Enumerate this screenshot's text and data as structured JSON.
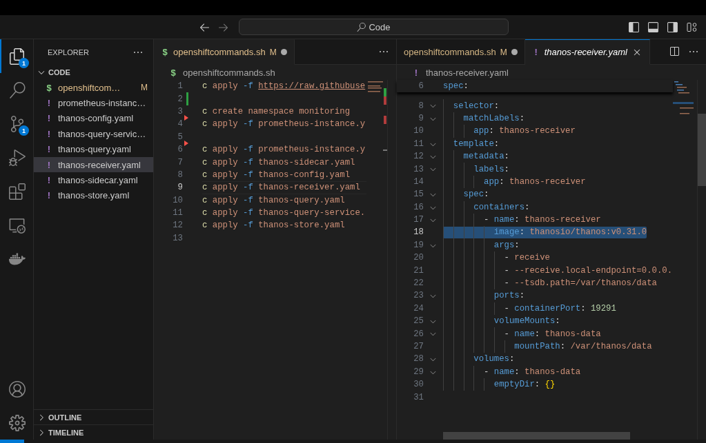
{
  "title_bar": {
    "search": "Code"
  },
  "activity_bar": [
    {
      "kind": "explorer",
      "selected": true,
      "badge": "1"
    },
    {
      "kind": "search",
      "selected": false
    },
    {
      "kind": "source-control",
      "selected": false,
      "badge": "1"
    },
    {
      "kind": "run-debug",
      "selected": false
    },
    {
      "kind": "extensions",
      "selected": false
    },
    {
      "kind": "remote",
      "selected": false
    },
    {
      "kind": "docker",
      "selected": false
    }
  ],
  "activity_bottom": [
    {
      "kind": "account"
    },
    {
      "kind": "settings"
    }
  ],
  "sidebar": {
    "title": "EXPLORER",
    "section": {
      "label": "CODE",
      "expanded": true,
      "files": [
        {
          "icon": "$",
          "kind": "shell",
          "name": "openshiftcom…",
          "status": "M",
          "selected": false
        },
        {
          "icon": "!",
          "kind": "yaml",
          "name": "prometheus-instanc…",
          "selected": false
        },
        {
          "icon": "!",
          "kind": "yaml",
          "name": "thanos-config.yaml",
          "selected": false
        },
        {
          "icon": "!",
          "kind": "yaml",
          "name": "thanos-query-servic…",
          "selected": false
        },
        {
          "icon": "!",
          "kind": "yaml",
          "name": "thanos-query.yaml",
          "selected": false
        },
        {
          "icon": "!",
          "kind": "yaml",
          "name": "thanos-receiver.yaml",
          "selected": true
        },
        {
          "icon": "!",
          "kind": "yaml",
          "name": "thanos-sidecar.yaml",
          "selected": false
        },
        {
          "icon": "!",
          "kind": "yaml",
          "name": "thanos-store.yaml",
          "selected": false
        }
      ]
    },
    "collapsed_sections": [
      {
        "label": "OUTLINE",
        "expanded": false
      },
      {
        "label": "TIMELINE",
        "expanded": false
      }
    ]
  },
  "editors": [
    {
      "tabs": [
        {
          "icon": "$",
          "kind": "shell",
          "label": "openshiftcommands.sh",
          "status": "M",
          "dirty": true,
          "selected": true,
          "preview": false,
          "focused": false
        }
      ],
      "breadcrumb": {
        "icon": "$",
        "kind": "shell",
        "label": "openshiftcommands.sh"
      },
      "lines": [
        {
          "n": "1",
          "kind": "code",
          "tokens": [
            {
              "text": "c",
              "kind": "cmd"
            },
            {
              "text": " apply ",
              "kind": "str"
            },
            {
              "text": "-f ",
              "kind": "flag"
            },
            {
              "text": "https://raw.githubuse",
              "kind": "link"
            }
          ]
        },
        {
          "n": "2",
          "kind": "added"
        },
        {
          "n": "3",
          "kind": "code",
          "tokens": [
            {
              "text": "c",
              "kind": "cmd"
            },
            {
              "text": " create namespace monitoring",
              "kind": "str"
            }
          ]
        },
        {
          "n": "4",
          "kind": "deleted",
          "tokens": [
            {
              "text": "c",
              "kind": "cmd"
            },
            {
              "text": " apply ",
              "kind": "str"
            },
            {
              "text": "-f",
              "kind": "flag"
            },
            {
              "text": " prometheus-instance.y",
              "kind": "str"
            }
          ]
        },
        {
          "n": "5",
          "kind": "code"
        },
        {
          "n": "6",
          "kind": "deleted",
          "tokens": [
            {
              "text": "c",
              "kind": "cmd"
            },
            {
              "text": " apply ",
              "kind": "str"
            },
            {
              "text": "-f",
              "kind": "flag"
            },
            {
              "text": " prometheus-instance.y",
              "kind": "str"
            }
          ]
        },
        {
          "n": "7",
          "kind": "code",
          "tokens": [
            {
              "text": "c",
              "kind": "cmd"
            },
            {
              "text": " apply ",
              "kind": "str"
            },
            {
              "text": "-f",
              "kind": "flag"
            },
            {
              "text": " thanos-sidecar.yaml",
              "kind": "str"
            }
          ]
        },
        {
          "n": "8",
          "kind": "code",
          "tokens": [
            {
              "text": "c",
              "kind": "cmd"
            },
            {
              "text": " apply ",
              "kind": "str"
            },
            {
              "text": "-f",
              "kind": "flag"
            },
            {
              "text": " thanos-config.yaml",
              "kind": "str"
            }
          ]
        },
        {
          "n": "9",
          "kind": "code",
          "current": true,
          "tokens": [
            {
              "text": "c",
              "kind": "cmd"
            },
            {
              "text": " apply ",
              "kind": "str"
            },
            {
              "text": "-f",
              "kind": "flag"
            },
            {
              "text": " thanos-receiver.yaml",
              "kind": "str"
            }
          ]
        },
        {
          "n": "10",
          "kind": "code",
          "tokens": [
            {
              "text": "c",
              "kind": "cmd"
            },
            {
              "text": " apply ",
              "kind": "str"
            },
            {
              "text": "-f",
              "kind": "flag"
            },
            {
              "text": " thanos-query.yaml",
              "kind": "str"
            }
          ]
        },
        {
          "n": "11",
          "kind": "code",
          "tokens": [
            {
              "text": "c",
              "kind": "cmd"
            },
            {
              "text": " apply ",
              "kind": "str"
            },
            {
              "text": "-f",
              "kind": "flag"
            },
            {
              "text": " thanos-query-service.",
              "kind": "str"
            }
          ]
        },
        {
          "n": "12",
          "kind": "code",
          "tokens": [
            {
              "text": "c",
              "kind": "cmd"
            },
            {
              "text": " apply ",
              "kind": "str"
            },
            {
              "text": "-f",
              "kind": "flag"
            },
            {
              "text": " thanos-store.yaml",
              "kind": "str"
            }
          ]
        },
        {
          "n": "13",
          "kind": "code"
        }
      ]
    },
    {
      "tabs": [
        {
          "label": "openshiftcommands.sh",
          "status": "M",
          "dirty": true,
          "selected": false,
          "preview": false,
          "focused": false
        },
        {
          "icon": "!",
          "kind": "yaml",
          "label": "thanos-receiver.yaml",
          "dirty": false,
          "selected": true,
          "preview": true,
          "focused": true
        }
      ],
      "breadcrumb": {
        "icon": "!",
        "kind": "yaml",
        "label": "thanos-receiver.yaml"
      },
      "sticky": {
        "n": "6",
        "tokens": [
          {
            "text": "spec",
            "kind": "key"
          },
          {
            "text": ":",
            "kind": "punct"
          }
        ]
      },
      "lines": [
        {
          "n": "8",
          "kind": "code",
          "fold": true,
          "tokens": [
            {
              "text": "  selector",
              "kind": "key"
            },
            {
              "text": ":",
              "kind": "punct"
            }
          ]
        },
        {
          "n": "9",
          "kind": "code",
          "fold": true,
          "tokens": [
            {
              "text": "    matchLabels",
              "kind": "key"
            },
            {
              "text": ":",
              "kind": "punct"
            }
          ]
        },
        {
          "n": "10",
          "kind": "code",
          "tokens": [
            {
              "text": "      app",
              "kind": "key"
            },
            {
              "text": ": ",
              "kind": "punct"
            },
            {
              "text": "thanos-receiver",
              "kind": "str"
            }
          ]
        },
        {
          "n": "11",
          "kind": "code",
          "fold": true,
          "tokens": [
            {
              "text": "  template",
              "kind": "key"
            },
            {
              "text": ":",
              "kind": "punct"
            }
          ]
        },
        {
          "n": "12",
          "kind": "code",
          "fold": true,
          "tokens": [
            {
              "text": "    metadata",
              "kind": "key"
            },
            {
              "text": ":",
              "kind": "punct"
            }
          ]
        },
        {
          "n": "13",
          "kind": "code",
          "fold": true,
          "tokens": [
            {
              "text": "      labels",
              "kind": "key"
            },
            {
              "text": ":",
              "kind": "punct"
            }
          ]
        },
        {
          "n": "14",
          "kind": "code",
          "tokens": [
            {
              "text": "        app",
              "kind": "key"
            },
            {
              "text": ": ",
              "kind": "punct"
            },
            {
              "text": "thanos-receiver",
              "kind": "str"
            }
          ]
        },
        {
          "n": "15",
          "kind": "code",
          "fold": true,
          "tokens": [
            {
              "text": "    spec",
              "kind": "key"
            },
            {
              "text": ":",
              "kind": "punct"
            }
          ]
        },
        {
          "n": "16",
          "kind": "code",
          "fold": true,
          "tokens": [
            {
              "text": "      containers",
              "kind": "key"
            },
            {
              "text": ":",
              "kind": "punct"
            }
          ]
        },
        {
          "n": "17",
          "kind": "code",
          "fold": true,
          "tokens": [
            {
              "text": "        - ",
              "kind": "punct"
            },
            {
              "text": "name",
              "kind": "key"
            },
            {
              "text": ": ",
              "kind": "punct"
            },
            {
              "text": "thanos-receiver",
              "kind": "str"
            }
          ]
        },
        {
          "n": "18",
          "kind": "code",
          "current": true,
          "selected": true,
          "tokens": [
            {
              "text": "          image",
              "kind": "key"
            },
            {
              "text": ": ",
              "kind": "punct"
            },
            {
              "text": "thanosio/thanos:v0.31.0",
              "kind": "str"
            }
          ]
        },
        {
          "n": "19",
          "kind": "code",
          "fold": true,
          "tokens": [
            {
              "text": "          args",
              "kind": "key"
            },
            {
              "text": ":",
              "kind": "punct"
            }
          ]
        },
        {
          "n": "20",
          "kind": "code",
          "tokens": [
            {
              "text": "            - ",
              "kind": "punct"
            },
            {
              "text": "receive",
              "kind": "str"
            }
          ]
        },
        {
          "n": "21",
          "kind": "code",
          "tokens": [
            {
              "text": "            - ",
              "kind": "punct"
            },
            {
              "text": "--receive.local-endpoint=0.0.0.",
              "kind": "str"
            }
          ]
        },
        {
          "n": "22",
          "kind": "code",
          "tokens": [
            {
              "text": "            - ",
              "kind": "punct"
            },
            {
              "text": "--tsdb.path=/var/thanos/data",
              "kind": "str"
            }
          ]
        },
        {
          "n": "23",
          "kind": "code",
          "fold": true,
          "tokens": [
            {
              "text": "          ports",
              "kind": "key"
            },
            {
              "text": ":",
              "kind": "punct"
            }
          ]
        },
        {
          "n": "24",
          "kind": "code",
          "tokens": [
            {
              "text": "            - ",
              "kind": "punct"
            },
            {
              "text": "containerPort",
              "kind": "key"
            },
            {
              "text": ": ",
              "kind": "punct"
            },
            {
              "text": "19291",
              "kind": "num"
            }
          ]
        },
        {
          "n": "25",
          "kind": "code",
          "fold": true,
          "tokens": [
            {
              "text": "          volumeMounts",
              "kind": "key"
            },
            {
              "text": ":",
              "kind": "punct"
            }
          ]
        },
        {
          "n": "26",
          "kind": "code",
          "fold": true,
          "tokens": [
            {
              "text": "            - ",
              "kind": "punct"
            },
            {
              "text": "name",
              "kind": "key"
            },
            {
              "text": ": ",
              "kind": "punct"
            },
            {
              "text": "thanos-data",
              "kind": "str"
            }
          ]
        },
        {
          "n": "27",
          "kind": "code",
          "tokens": [
            {
              "text": "              mountPath",
              "kind": "key"
            },
            {
              "text": ": ",
              "kind": "punct"
            },
            {
              "text": "/var/thanos/data",
              "kind": "str"
            }
          ]
        },
        {
          "n": "28",
          "kind": "code",
          "fold": true,
          "tokens": [
            {
              "text": "      volumes",
              "kind": "key"
            },
            {
              "text": ":",
              "kind": "punct"
            }
          ]
        },
        {
          "n": "29",
          "kind": "code",
          "fold": true,
          "tokens": [
            {
              "text": "        - ",
              "kind": "punct"
            },
            {
              "text": "name",
              "kind": "key"
            },
            {
              "text": ": ",
              "kind": "punct"
            },
            {
              "text": "thanos-data",
              "kind": "str"
            }
          ]
        },
        {
          "n": "30",
          "kind": "code",
          "tokens": [
            {
              "text": "          emptyDir",
              "kind": "key"
            },
            {
              "text": ": ",
              "kind": "punct"
            },
            {
              "text": "{}",
              "kind": "brace"
            }
          ]
        },
        {
          "n": "31",
          "kind": "code"
        }
      ]
    }
  ]
}
